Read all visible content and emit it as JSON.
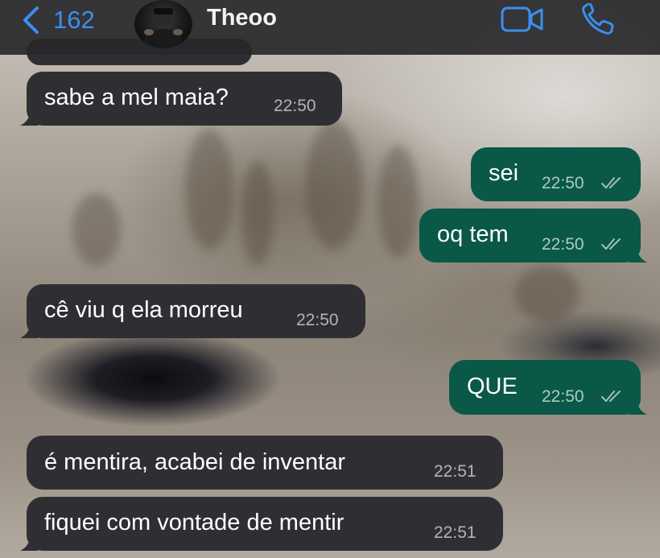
{
  "header": {
    "back_count": "162",
    "contact_name": "Theoo",
    "accent_color": "#3b8ff0"
  },
  "messages": [
    {
      "direction": "incoming",
      "text": "sabe a mel maia?",
      "time": "22:50"
    },
    {
      "direction": "outgoing",
      "text": "sei",
      "time": "22:50",
      "status": "read"
    },
    {
      "direction": "outgoing",
      "text": "oq tem",
      "time": "22:50",
      "status": "read"
    },
    {
      "direction": "incoming",
      "text": "cê viu q ela morreu",
      "time": "22:50"
    },
    {
      "direction": "outgoing",
      "text": "QUE",
      "time": "22:50",
      "status": "read"
    },
    {
      "direction": "incoming",
      "text": "é mentira, acabei de inventar",
      "time": "22:51"
    },
    {
      "direction": "incoming",
      "text": "fiquei com vontade de mentir",
      "time": "22:51"
    }
  ],
  "colors": {
    "incoming_bubble": "#2f2f33",
    "outgoing_bubble": "#0a5848",
    "header_bg": "#28282a"
  },
  "icons": [
    "chevron-left-icon",
    "video-camera-icon",
    "phone-icon",
    "double-check-icon"
  ]
}
